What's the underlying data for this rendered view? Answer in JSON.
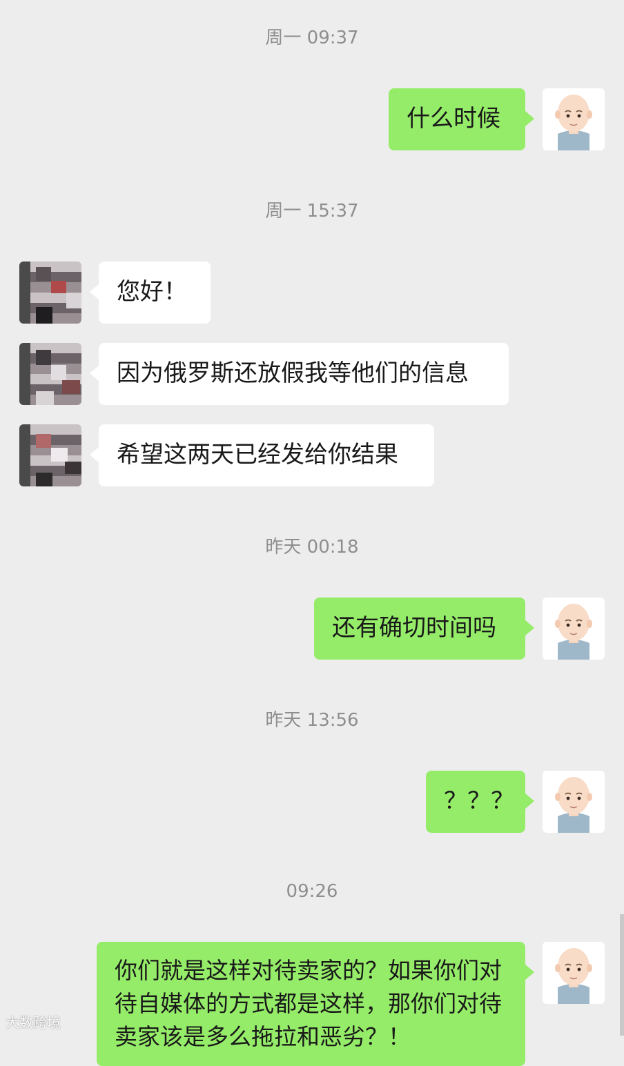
{
  "messages": {
    "t1": "周一 09:37",
    "m1": "什么时候",
    "t2": "周一 15:37",
    "m2": "您好！",
    "m3": "因为俄罗斯还放假我等他们的信息",
    "m4": "希望这两天已经发给你结果",
    "t3": "昨天 00:18",
    "m5": "还有确切时间吗",
    "t4": "昨天 13:56",
    "m6": "？？？",
    "t5": "09:26",
    "m7": "你们就是这样对待卖家的？如果你们对待自媒体的方式都是这样，那你们对待卖家该是多么拖拉和恶劣？！"
  },
  "watermark": "大数跨境",
  "colors": {
    "background": "#ededed",
    "my_bubble": "#95ec69",
    "their_bubble": "#ffffff",
    "timestamp": "#8e8e8e"
  },
  "icons": {
    "my_avatar": "bald-man-avatar-icon",
    "their_avatar": "pixelated-avatar-icon"
  }
}
